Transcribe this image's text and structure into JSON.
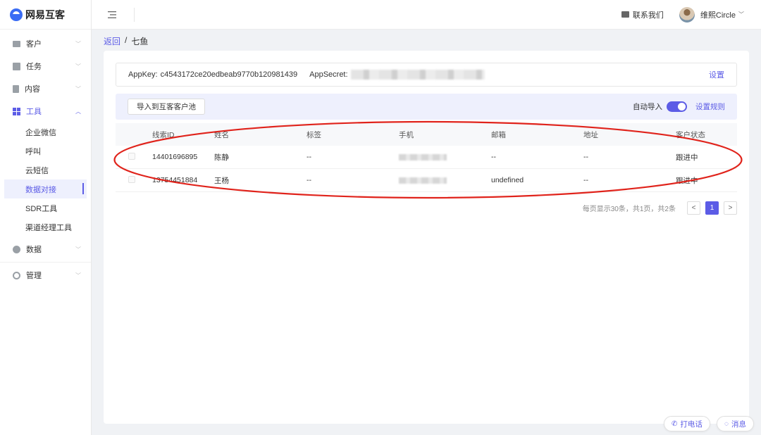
{
  "app": {
    "logo_text": "网易互客"
  },
  "sidebar": {
    "items": [
      {
        "label": "客户",
        "icon": "id-card-icon"
      },
      {
        "label": "任务",
        "icon": "task-icon"
      },
      {
        "label": "内容",
        "icon": "document-icon"
      },
      {
        "label": "工具",
        "icon": "grid-icon",
        "expanded": true
      },
      {
        "label": "数据",
        "icon": "pie-chart-icon"
      },
      {
        "label": "管理",
        "icon": "gear-icon"
      }
    ],
    "tool_subitems": [
      "企业微信",
      "呼叫",
      "云短信",
      "数据对接",
      "SDR工具",
      "渠道经理工具"
    ],
    "active_subitem": "数据对接"
  },
  "header": {
    "contact_label": "联系我们",
    "user_name": "维熙Circle"
  },
  "breadcrumb": {
    "back": "返回",
    "separator": "/",
    "current": "七鱼"
  },
  "keys": {
    "appkey_label": "AppKey:",
    "appkey_value": "c4543172ce20edbeab9770b120981439",
    "appsecret_label": "AppSecret:",
    "settings_label": "设置"
  },
  "toolbar": {
    "import_label": "导入到互客客户池",
    "auto_import_label": "自动导入",
    "auto_import_on": true,
    "rules_label": "设置规则"
  },
  "table": {
    "columns": [
      "线索ID",
      "姓名",
      "标签",
      "手机",
      "邮箱",
      "地址",
      "客户状态"
    ],
    "rows": [
      {
        "id": "14401696895",
        "name": "陈静",
        "tag": "--",
        "email": "--",
        "address": "--",
        "status": "跟进中"
      },
      {
        "id": "13754451884",
        "name": "王杨",
        "tag": "--",
        "email": "undefined",
        "address": "--",
        "status": "跟进中"
      }
    ]
  },
  "pagination": {
    "info": "每页显示30条，共1页，共2条",
    "current_page": "1",
    "prev": "<",
    "next": ">"
  },
  "floating": {
    "call_label": "打电话",
    "message_label": "消息"
  },
  "colors": {
    "accent": "#5c5ce6",
    "annotation": "#e0231b"
  }
}
